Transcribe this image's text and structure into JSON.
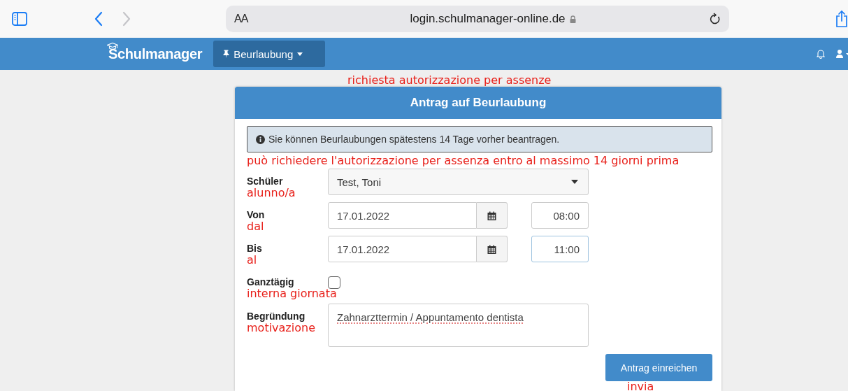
{
  "browser": {
    "text_size": "AA",
    "url": "login.schulmanager-online.de",
    "back_disabled": false,
    "forward_disabled": true
  },
  "navbar": {
    "brand": "Schulmanager",
    "menu": "Beurlaubung"
  },
  "title_annotation": "richiesta autorizzazione per assenze",
  "card": {
    "title": "Antrag auf Beurlaubung",
    "info": "Sie können Beurlaubungen spätestens 14 Tage vorher beantragen.",
    "info_annotation": "può richiedere l'autorizzazione per assenza entro al massimo 14 giorni prima",
    "fields": [
      {
        "kind": "select",
        "label": "Schüler",
        "annotation": "alunno/a",
        "value": "Test, Toni"
      },
      {
        "kind": "datetime",
        "label": "Von",
        "annotation": "dal",
        "date": "17.01.2022",
        "time": "08:00",
        "focused": false
      },
      {
        "kind": "datetime",
        "label": "Bis",
        "annotation": "al",
        "date": "17.01.2022",
        "time": "11:00",
        "focused": true
      },
      {
        "kind": "checkbox",
        "label": "Ganztägig",
        "annotation": "interna giornata",
        "checked": false
      },
      {
        "kind": "textarea",
        "label": "Begründung",
        "annotation": "motivazione",
        "value": "Zahnarzttermin / Appuntamento dentista"
      }
    ],
    "submit": {
      "label": "Antrag einreichen",
      "annotation": "invia"
    }
  }
}
